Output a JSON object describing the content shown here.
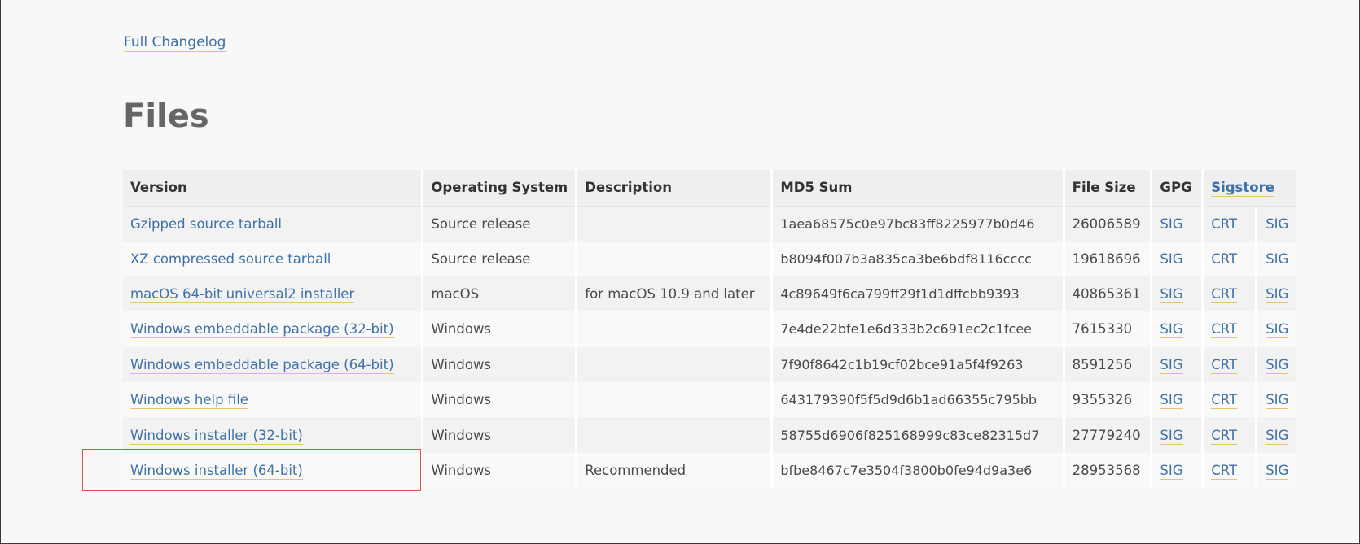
{
  "top_partial_text": "",
  "changelog_link": "Full Changelog",
  "files": {
    "heading": "Files",
    "headers": {
      "version": "Version",
      "os": "Operating System",
      "description": "Description",
      "md5": "MD5 Sum",
      "size": "File Size",
      "gpg": "GPG",
      "sigstore": "Sigstore"
    },
    "rows": [
      {
        "version": "Gzipped source tarball",
        "os": "Source release",
        "description": "",
        "md5": "1aea68575c0e97bc83ff8225977b0d46",
        "size": "26006589",
        "gpg": "SIG",
        "crt": "CRT",
        "sig": "SIG"
      },
      {
        "version": "XZ compressed source tarball",
        "os": "Source release",
        "description": "",
        "md5": "b8094f007b3a835ca3be6bdf8116cccc",
        "size": "19618696",
        "gpg": "SIG",
        "crt": "CRT",
        "sig": "SIG"
      },
      {
        "version": "macOS 64-bit universal2 installer",
        "os": "macOS",
        "description": "for macOS 10.9 and later",
        "md5": "4c89649f6ca799ff29f1d1dffcbb9393",
        "size": "40865361",
        "gpg": "SIG",
        "crt": "CRT",
        "sig": "SIG"
      },
      {
        "version": "Windows embeddable package (32-bit)",
        "os": "Windows",
        "description": "",
        "md5": "7e4de22bfe1e6d333b2c691ec2c1fcee",
        "size": "7615330",
        "gpg": "SIG",
        "crt": "CRT",
        "sig": "SIG"
      },
      {
        "version": "Windows embeddable package (64-bit)",
        "os": "Windows",
        "description": "",
        "md5": "7f90f8642c1b19cf02bce91a5f4f9263",
        "size": "8591256",
        "gpg": "SIG",
        "crt": "CRT",
        "sig": "SIG"
      },
      {
        "version": "Windows help file",
        "os": "Windows",
        "description": "",
        "md5": "643179390f5f5d9d6b1ad66355c795bb",
        "size": "9355326",
        "gpg": "SIG",
        "crt": "CRT",
        "sig": "SIG"
      },
      {
        "version": "Windows installer (32-bit)",
        "os": "Windows",
        "description": "",
        "md5": "58755d6906f825168999c83ce82315d7",
        "size": "27779240",
        "gpg": "SIG",
        "crt": "CRT",
        "sig": "SIG"
      },
      {
        "version": "Windows installer (64-bit)",
        "os": "Windows",
        "description": "Recommended",
        "md5": "bfbe8467c7e3504f3800b0fe94d9a3e6",
        "size": "28953568",
        "gpg": "SIG",
        "crt": "CRT",
        "sig": "SIG"
      }
    ]
  },
  "colors": {
    "link": "#3f72a8",
    "link_underline": "#e6c46a",
    "highlight_box": "#e05050"
  }
}
